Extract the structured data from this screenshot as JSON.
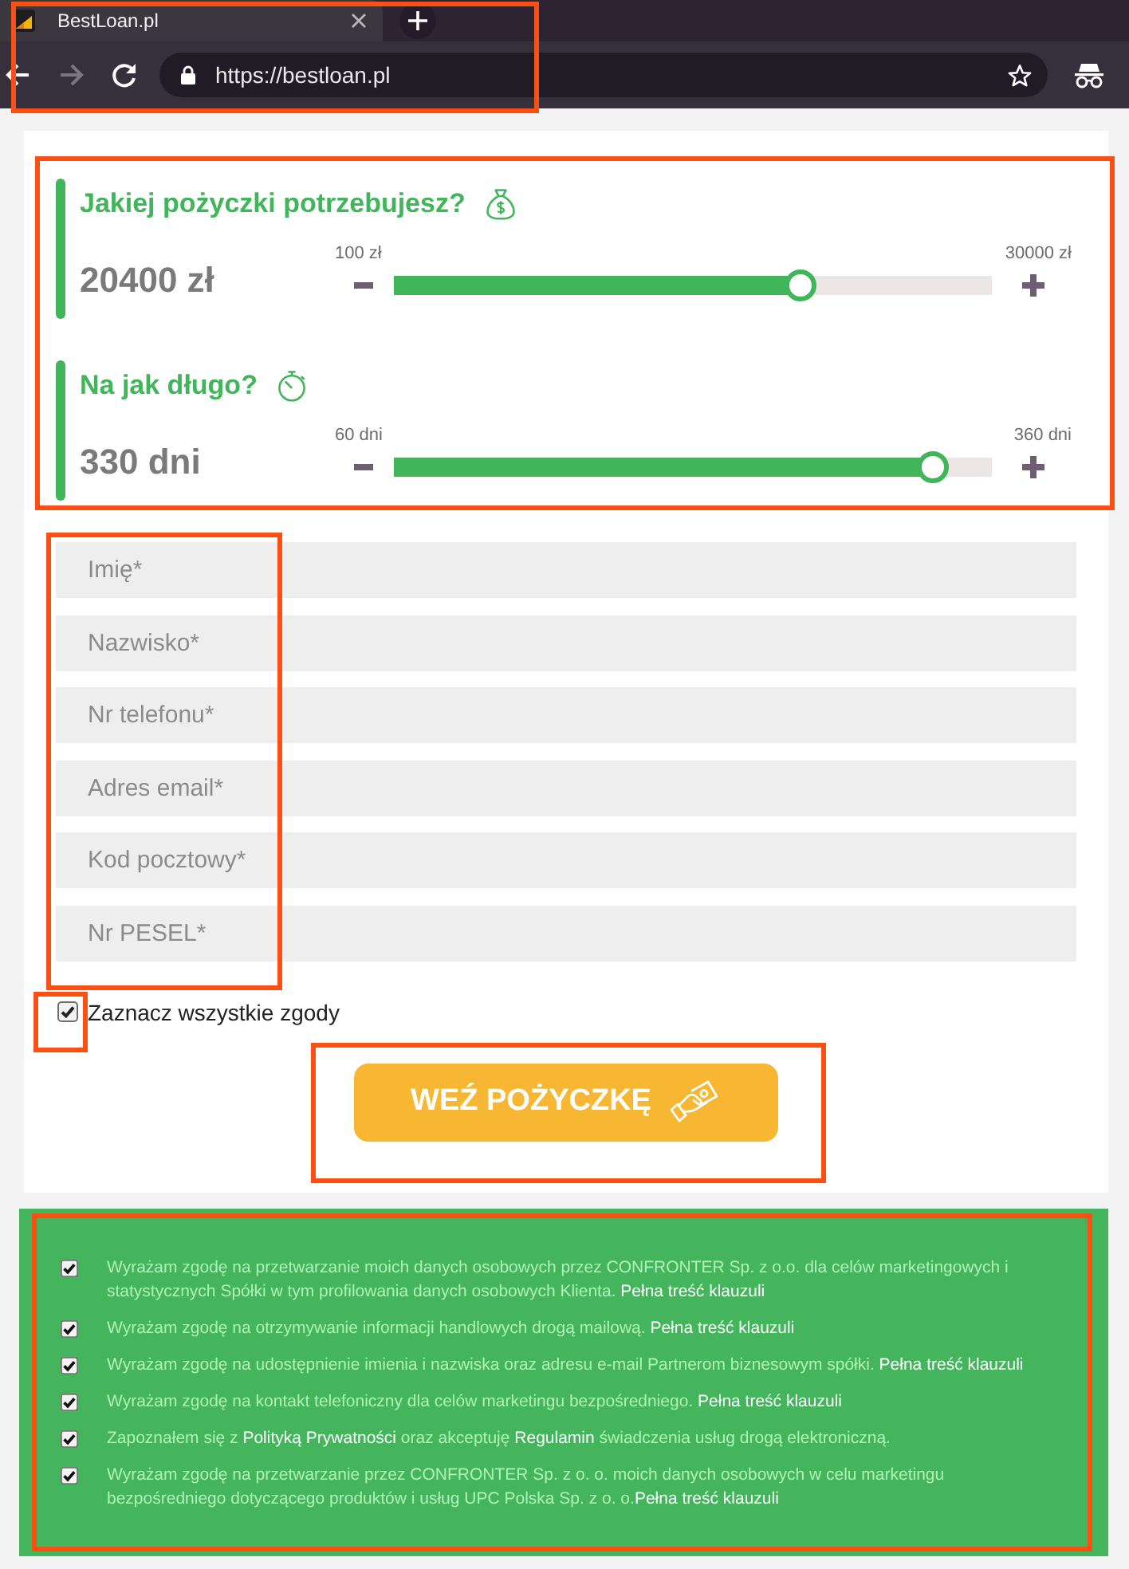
{
  "browser": {
    "tab_title": "BestLoan.pl",
    "url": "https://bestloan.pl",
    "forward_disabled": true
  },
  "loan": {
    "sliders": [
      {
        "kind": "amount",
        "title": "Jakiej pożyczki potrzebujesz?",
        "value": "20400 zł",
        "min_label": "100 zł",
        "max_label": "30000 zł",
        "level": 0.68
      },
      {
        "kind": "duration",
        "title": "Na jak długo?",
        "value": "330 dni",
        "min_label": "60 dni",
        "max_label": "360 dni",
        "level": 0.9
      }
    ]
  },
  "form": {
    "fields": [
      {
        "placeholder": "Imię*"
      },
      {
        "placeholder": "Nazwisko*"
      },
      {
        "placeholder": "Nr telefonu*"
      },
      {
        "placeholder": "Adres email*"
      },
      {
        "placeholder": "Kod pocztowy*"
      },
      {
        "placeholder": "Nr PESEL*"
      }
    ],
    "select_all": {
      "label": "Zaznacz wszystkie zgody",
      "checked": true
    },
    "submit": "WEŹ POŻYCZKĘ"
  },
  "consents": [
    {
      "checked": true,
      "segments": [
        {
          "kind": "text",
          "text": "Wyrażam zgodę na przetwarzanie moich danych osobowych przez CONFRONTER Sp. z o.o. dla celów marketingowych i statystycznych Spółki w tym profilowania danych osobowych Klienta. "
        },
        {
          "kind": "link",
          "text": "Pełna treść klauzuli"
        }
      ]
    },
    {
      "checked": true,
      "segments": [
        {
          "kind": "text",
          "text": "Wyrażam zgodę na otrzymywanie informacji handlowych drogą mailową. "
        },
        {
          "kind": "link",
          "text": "Pełna treść klauzuli"
        }
      ]
    },
    {
      "checked": true,
      "segments": [
        {
          "kind": "text",
          "text": "Wyrażam zgodę na udostępnienie imienia i nazwiska oraz adresu e-mail Partnerom biznesowym spółki. "
        },
        {
          "kind": "link",
          "text": "Pełna treść klauzuli"
        }
      ]
    },
    {
      "checked": true,
      "segments": [
        {
          "kind": "text",
          "text": "Wyrażam zgodę na kontakt telefoniczny dla celów marketingu bezpośredniego. "
        },
        {
          "kind": "link",
          "text": "Pełna treść klauzuli"
        }
      ]
    },
    {
      "checked": true,
      "segments": [
        {
          "kind": "text",
          "text": "Zapoznałem się z "
        },
        {
          "kind": "link",
          "text": "Polityką Prywatności"
        },
        {
          "kind": "text",
          "text": " oraz akceptuję "
        },
        {
          "kind": "link",
          "text": "Regulamin"
        },
        {
          "kind": "text",
          "text": " świadczenia usług drogą elektroniczną."
        }
      ]
    },
    {
      "checked": true,
      "segments": [
        {
          "kind": "text",
          "text": "Wyrażam zgodę na przetwarzanie przez CONFRONTER Sp. z o. o. moich danych osobowych w celu marketingu bezpośredniego dotyczącego produktów i usług UPC Polska Sp. z o. o."
        },
        {
          "kind": "link",
          "text": "Pełna treść klauzuli"
        }
      ]
    }
  ]
}
